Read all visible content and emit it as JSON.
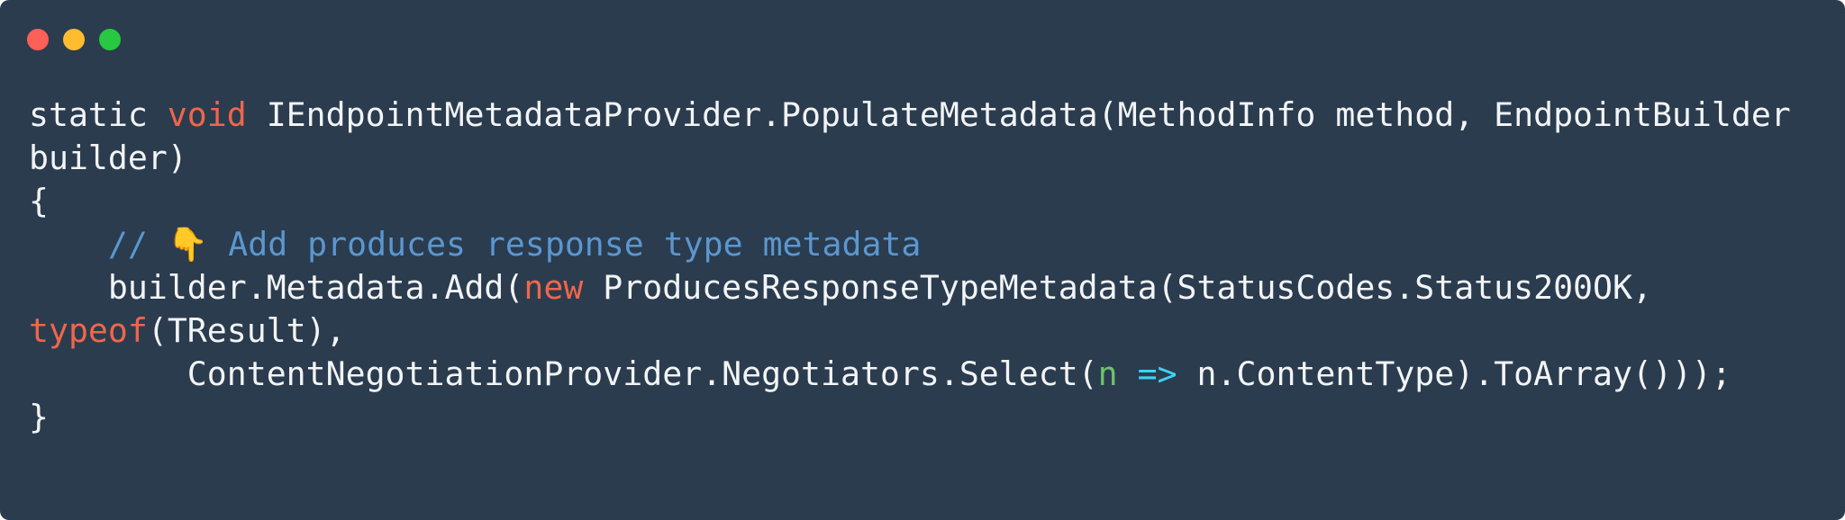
{
  "window": {
    "background": "#2b3c4f",
    "controls": [
      {
        "name": "close",
        "color": "#fe5f57"
      },
      {
        "name": "minimize",
        "color": "#febc2e"
      },
      {
        "name": "maximize",
        "color": "#28c840"
      }
    ]
  },
  "theme": {
    "plain": "#f2f4f6",
    "keyword": "#f0664a",
    "comment": "#5b97cf",
    "parameter": "#6cc26c",
    "operator": "#3fd3f0"
  },
  "code": {
    "lines": [
      [
        {
          "type": "plain",
          "text": "static "
        },
        {
          "type": "keyword",
          "text": "void"
        },
        {
          "type": "plain",
          "text": " IEndpointMetadataProvider.PopulateMetadata(MethodInfo method, EndpointBuilder"
        }
      ],
      [
        {
          "type": "plain",
          "text": "builder)"
        }
      ],
      [
        {
          "type": "plain",
          "text": "{"
        }
      ],
      [
        {
          "type": "plain",
          "text": "    "
        },
        {
          "type": "comment",
          "text": "// 👇 Add produces response type metadata"
        }
      ],
      [
        {
          "type": "plain",
          "text": "    builder.Metadata.Add("
        },
        {
          "type": "keyword",
          "text": "new"
        },
        {
          "type": "plain",
          "text": " ProducesResponseTypeMetadata(StatusCodes.Status200OK,"
        }
      ],
      [
        {
          "type": "keyword",
          "text": "typeof"
        },
        {
          "type": "plain",
          "text": "(TResult),"
        }
      ],
      [
        {
          "type": "plain",
          "text": "        ContentNegotiationProvider.Negotiators.Select("
        },
        {
          "type": "param",
          "text": "n"
        },
        {
          "type": "plain",
          "text": " "
        },
        {
          "type": "arrow",
          "text": "=>"
        },
        {
          "type": "plain",
          "text": " n.ContentType).ToArray()));"
        }
      ],
      [
        {
          "type": "plain",
          "text": "}"
        }
      ]
    ]
  }
}
